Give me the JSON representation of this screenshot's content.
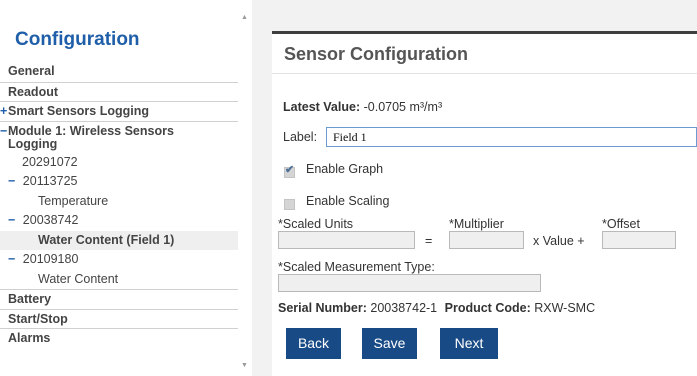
{
  "sidebar": {
    "title": "Configuration",
    "items": [
      {
        "label": "General"
      },
      {
        "label": "Readout"
      },
      {
        "label": "Smart Sensors Logging",
        "marker": "+"
      },
      {
        "label": "Module 1: Wireless Sensors",
        "label2": "Logging",
        "marker": "−"
      },
      {
        "label": "20291072"
      },
      {
        "label": "20113725",
        "marker": "−"
      },
      {
        "label": "Temperature"
      },
      {
        "label": "20038742",
        "marker": "−"
      },
      {
        "label": "Water Content (Field 1)"
      },
      {
        "label": "20109180",
        "marker": "−"
      },
      {
        "label": "Water Content"
      },
      {
        "label": "Battery"
      },
      {
        "label": "Start/Stop"
      },
      {
        "label": "Alarms"
      }
    ]
  },
  "main": {
    "heading": "Sensor Configuration",
    "latest_value_label": "Latest Value:",
    "latest_value": "-0.0705 m³/m³",
    "label_label": "Label:",
    "label_value": "Field 1",
    "enable_graph": {
      "label": "Enable Graph",
      "checked": true
    },
    "enable_scaling": {
      "label": "Enable Scaling",
      "checked": false
    },
    "scaled_units_label": "*Scaled Units",
    "multiplier_label": "*Multiplier",
    "offset_label": "*Offset",
    "equals": "=",
    "x_value_plus": "x Value +",
    "scaled_measurement_type_label": "*Scaled Measurement Type:",
    "serial_number_label": "Serial Number:",
    "serial_number": "20038742-1",
    "product_code_label": "Product Code:",
    "product_code": "RXW-SMC",
    "buttons": {
      "back": "Back",
      "save": "Save",
      "next": "Next"
    }
  },
  "colors": {
    "brand_blue": "#1f5ea8",
    "button_bg": "#184a86",
    "active_row": "#efefef"
  }
}
